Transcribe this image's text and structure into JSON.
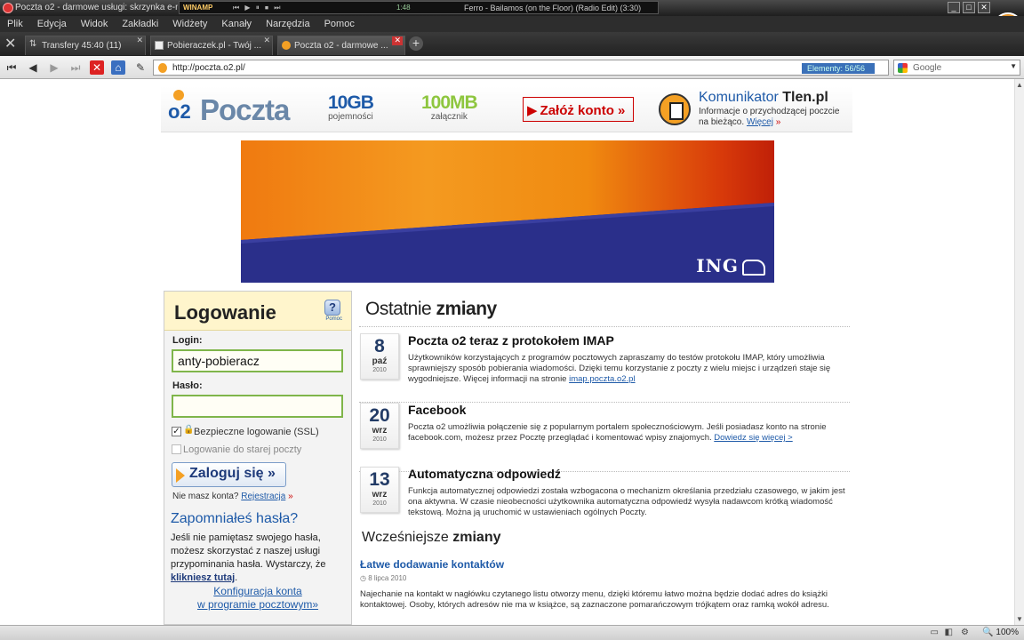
{
  "window": {
    "title": "Poczta o2 - darmowe usługi: skrzynka e-mail",
    "winamp_label": "WINAMP",
    "winamp_clock": "1:48",
    "winamp_track": "Ferro - Bailamos (on the Floor) (Radio Edit) (3:30)"
  },
  "menu": [
    "Plik",
    "Edycja",
    "Widok",
    "Zakładki",
    "Widżety",
    "Kanały",
    "Narzędzia",
    "Pomoc"
  ],
  "tabs": [
    {
      "label": "Transfery 45:40 (11)"
    },
    {
      "label": "Pobieraczek.pl - Twój ..."
    },
    {
      "label": "Poczta o2 - darmowe ..."
    }
  ],
  "nav": {
    "url": "http://poczta.o2.pl/",
    "elements": "Elementy: 56/56",
    "search_placeholder": "Google"
  },
  "header": {
    "brand_prefix": "o2",
    "brand": "Poczta",
    "stat1_value": "10GB",
    "stat1_label": "pojemności",
    "stat2_value": "100MB",
    "stat2_label": "załącznik",
    "signup_label": "Załóż konto »",
    "tlen_title_a": "Komunikator ",
    "tlen_title_b": "Tlen.pl",
    "tlen_desc": "Informacje o przychodzącej poczcie na bieżąco.",
    "tlen_link": "Więcej",
    "tlen_arrow": "»"
  },
  "banner": {
    "brand": "ING"
  },
  "login": {
    "title": "Logowanie",
    "help_label": "Pomoc",
    "login_label": "Login:",
    "login_value": "anty-pobieracz",
    "password_label": "Hasło:",
    "password_value": "",
    "ssl_label": "Bezpieczne logowanie (SSL)",
    "old_label": "Logowanie do starej poczty",
    "submit_label": "Zaloguj się »",
    "no_account": "Nie masz konta?",
    "register_link": "Rejestracja",
    "register_arrow": "»",
    "forgot_title": "Zapomniałeś hasła?",
    "forgot_text": "Jeśli nie pamiętasz swojego hasła, możesz skorzystać z naszej usługi przypominania hasła. Wystarczy, że",
    "forgot_link": "klikniesz tutaj",
    "forgot_end": ".",
    "config_line1": "Konfiguracja konta",
    "config_line2": "w programie pocztowym»"
  },
  "recent": {
    "heading_a": "Ostatnie ",
    "heading_b": "zmiany",
    "items": [
      {
        "day": "8",
        "month": "paź",
        "year": "2010",
        "title": "Poczta o2 teraz z protokołem IMAP",
        "text": "Użytkowników korzystających z programów pocztowych zapraszamy do testów protokołu IMAP, który umożliwia sprawniejszy sposób pobierania wiadomości. Dzięki temu korzystanie z poczty z wielu miejsc i urządzeń staje się wygodniejsze. Więcej informacji na stronie ",
        "link": "imap.poczta.o2.pl"
      },
      {
        "day": "20",
        "month": "wrz",
        "year": "2010",
        "title": "Facebook",
        "text": "Poczta o2 umożliwia połączenie się z popularnym portalem społecznościowym. Jeśli posiadasz konto na stronie facebook.com, możesz przez Pocztę przeglądać i komentować wpisy znajomych. ",
        "link": "Dowiedz się więcej >"
      },
      {
        "day": "13",
        "month": "wrz",
        "year": "2010",
        "title": "Automatyczna odpowiedź",
        "text": "Funkcja automatycznej odpowiedzi została wzbogacona o mechanizm określania przedziału czasowego, w jakim jest ona aktywna. W czasie nieobecności użytkownika automatyczna odpowiedź wysyła nadawcom krótką wiadomość tekstową. Można ją uruchomić w ustawieniach ogólnych Poczty.",
        "link": ""
      }
    ],
    "earlier_a": "Wcześniejsze ",
    "earlier_b": "zmiany",
    "earlier_title": "Łatwe dodawanie kontaktów",
    "earlier_date": "8 lipca 2010",
    "earlier_text": "Najechanie na kontakt w nagłówku czytanego listu otworzy menu, dzięki któremu łatwo można będzie dodać adres do książki kontaktowej. Osoby, których adresów nie ma w książce, są zaznaczone pomarańczowym trójkątem oraz ramką wokół adresu."
  },
  "status": {
    "zoom": "100%"
  },
  "colors": {
    "accent": "#1e5aa8",
    "orange": "#f4a024",
    "brand_red": "#cc0000"
  }
}
